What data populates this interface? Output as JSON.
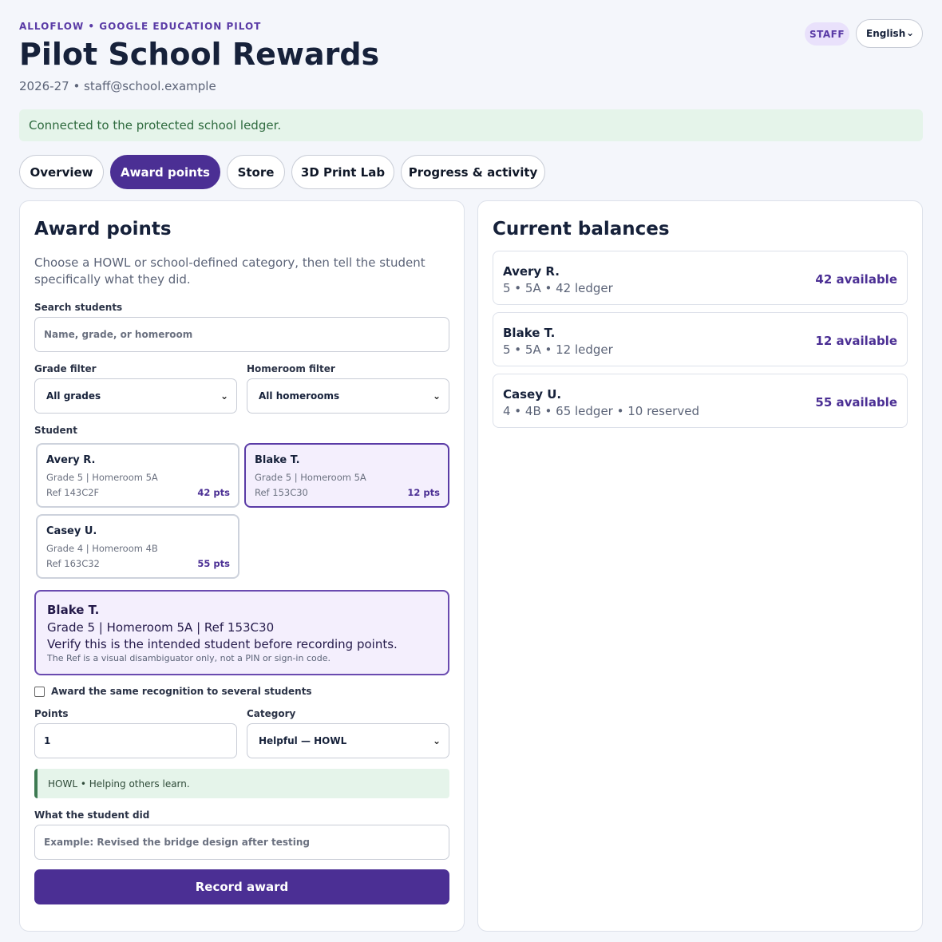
{
  "header": {
    "eyebrow": "ALLOFLOW • GOOGLE EDUCATION PILOT",
    "title": "Pilot School Rewards",
    "subtitle": "2026-27 • staff@school.example",
    "role_badge": "STAFF",
    "language": "English"
  },
  "status": "Connected to the protected school ledger.",
  "tabs": [
    {
      "label": "Overview",
      "active": false
    },
    {
      "label": "Award points",
      "active": true
    },
    {
      "label": "Store",
      "active": false
    },
    {
      "label": "3D Print Lab",
      "active": false
    },
    {
      "label": "Progress & activity",
      "active": false
    }
  ],
  "award": {
    "heading": "Award points",
    "description_line1": "Choose a HOWL or school-defined category, then tell the student",
    "description_line2": "specifically what they did.",
    "search_label": "Search students",
    "search_placeholder": "Name, grade, or homeroom",
    "grade_filter_label": "Grade filter",
    "grade_filter_value": "All grades",
    "homeroom_filter_label": "Homeroom filter",
    "homeroom_filter_value": "All homerooms",
    "student_label": "Student",
    "students": [
      {
        "name": "Avery R.",
        "meta": "Grade 5 | Homeroom 5A",
        "ref": "Ref 143C2F",
        "pts": "42 pts",
        "selected": false
      },
      {
        "name": "Blake T.",
        "meta": "Grade 5 | Homeroom 5A",
        "ref": "Ref 153C30",
        "pts": "12 pts",
        "selected": true
      },
      {
        "name": "Casey U.",
        "meta": "Grade 4 | Homeroom 4B",
        "ref": "Ref 163C32",
        "pts": "55 pts",
        "selected": false
      }
    ],
    "selected": {
      "name": "Blake T.",
      "details": "Grade 5 | Homeroom 5A | Ref 153C30",
      "verify": "Verify this is the intended student before recording points.",
      "note": "The Ref is a visual disambiguator only, not a PIN or sign-in code."
    },
    "multi_label": "Award the same recognition to several students",
    "multi_checked": false,
    "points_label": "Points",
    "points_value": "1",
    "category_label": "Category",
    "category_value": "Helpful — HOWL",
    "category_hint": "HOWL • Helping others learn.",
    "did_label": "What the student did",
    "did_placeholder": "Example: Revised the bridge design after testing",
    "submit_label": "Record award"
  },
  "balances": {
    "heading": "Current balances",
    "items": [
      {
        "name": "Avery R.",
        "meta": "5 • 5A • 42 ledger",
        "available": "42 available"
      },
      {
        "name": "Blake T.",
        "meta": "5 • 5A • 12 ledger",
        "available": "12 available"
      },
      {
        "name": "Casey U.",
        "meta": "4 • 4B • 65 ledger • 10 reserved",
        "available": "55 available"
      }
    ]
  },
  "colors": {
    "accent": "#4b2f94",
    "accent_light": "#f4effd",
    "success_bg": "#e5f4ea",
    "success_text": "#2e6a3e"
  },
  "icons": {
    "dropdown": "chevron-down-icon"
  }
}
